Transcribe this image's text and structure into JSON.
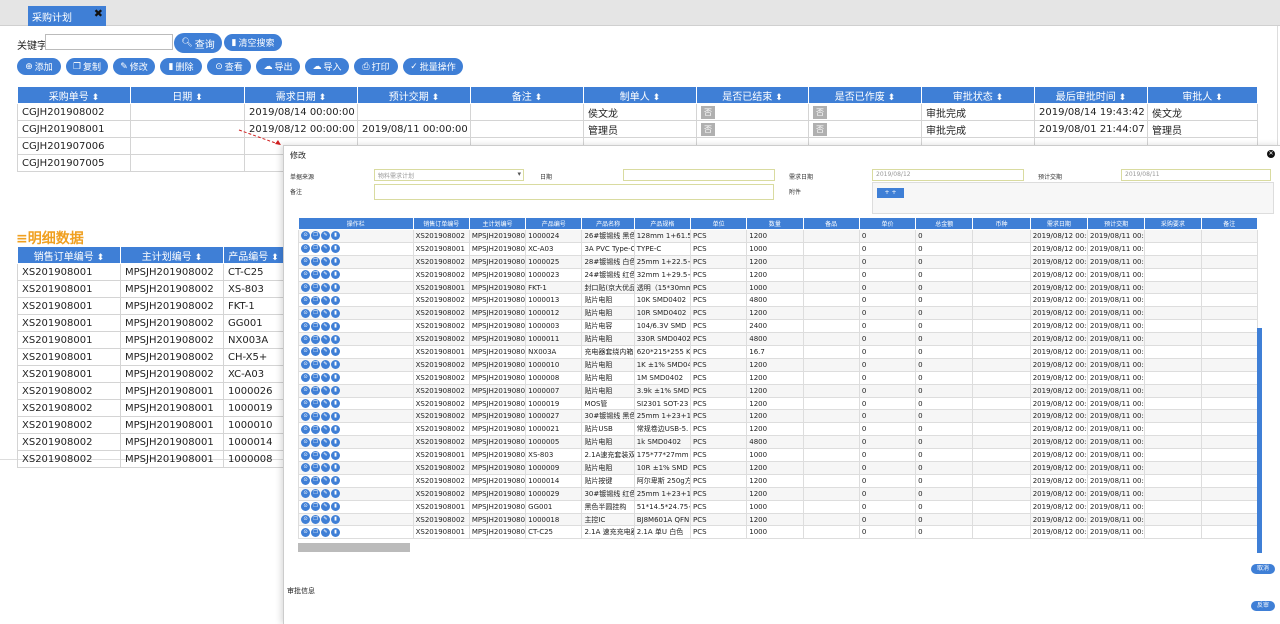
{
  "tab": {
    "title": "采购计划",
    "close": "✖"
  },
  "search": {
    "label": "关键字",
    "query": "查询",
    "clear": "清空搜索"
  },
  "toolbar": [
    "添加",
    "复制",
    "修改",
    "删除",
    "查看",
    "导出",
    "导入",
    "打印",
    "批量操作"
  ],
  "main_table": {
    "headers": [
      "采购单号",
      "日期",
      "需求日期",
      "预计交期",
      "备注",
      "制单人",
      "是否已结束",
      "是否已作废",
      "审批状态",
      "最后审批时间",
      "审批人"
    ],
    "rows": [
      [
        "CGJH201908002",
        "",
        "2019/08/14 00:00:00",
        "",
        "",
        "侯文龙",
        "否",
        "否",
        "审批完成",
        "2019/08/14 19:43:42",
        "侯文龙"
      ],
      [
        "CGJH201908001",
        "",
        "2019/08/12 00:00:00",
        "2019/08/11 00:00:00",
        "",
        "管理员",
        "否",
        "否",
        "审批完成",
        "2019/08/01 21:44:07",
        "管理员"
      ],
      [
        "CGJH201907006",
        "",
        "",
        "",
        "",
        "",
        "",
        "",
        "",
        "",
        ""
      ],
      [
        "CGJH201907005",
        "",
        "",
        "",
        "",
        "",
        "",
        "",
        "",
        "",
        ""
      ]
    ]
  },
  "detail": {
    "title": "≡明细数据",
    "headers": [
      "销售订单编号",
      "主计划编号",
      "产品编号"
    ],
    "rows": [
      [
        "XS201908001",
        "MPSJH201908002",
        "CT-C25"
      ],
      [
        "XS201908001",
        "MPSJH201908002",
        "XS-803"
      ],
      [
        "XS201908001",
        "MPSJH201908002",
        "FKT-1"
      ],
      [
        "XS201908001",
        "MPSJH201908002",
        "GG001"
      ],
      [
        "XS201908001",
        "MPSJH201908002",
        "NX003A"
      ],
      [
        "XS201908001",
        "MPSJH201908002",
        "CH-X5+"
      ],
      [
        "XS201908001",
        "MPSJH201908002",
        "XC-A03"
      ],
      [
        "XS201908002",
        "MPSJH201908001",
        "1000026"
      ],
      [
        "XS201908002",
        "MPSJH201908001",
        "1000019"
      ],
      [
        "XS201908002",
        "MPSJH201908001",
        "1000010"
      ],
      [
        "XS201908002",
        "MPSJH201908001",
        "1000014"
      ],
      [
        "XS201908002",
        "MPSJH201908001",
        "1000008"
      ]
    ]
  },
  "modal": {
    "title": "修改",
    "form": {
      "source_label": "单据来源",
      "source_value": "物料需求计划",
      "date_label": "日期",
      "date_value": "",
      "need_label": "需求日期",
      "need_value": "2019/08/12",
      "expect_label": "预计交期",
      "expect_value": "2019/08/11",
      "remark_label": "备注",
      "attach_label": "附件",
      "add_label": "+ +"
    },
    "headers": [
      "操作栏",
      "销售订单编号",
      "主计划编号",
      "产品编号",
      "产品名称",
      "产品规格",
      "单位",
      "数量",
      "备品",
      "单价",
      "总金额",
      "币种",
      "需求日期",
      "预计交期",
      "采购要求",
      "备注"
    ],
    "rows": [
      [
        "XS201908002",
        "MPSJH2019080",
        "1000024",
        "26#镀锡线 黑色",
        "128mm 1+61.5",
        "PCS",
        "1200",
        "",
        "0",
        "0",
        "",
        "2019/08/12 00:",
        "2019/08/11 00:",
        "",
        ""
      ],
      [
        "XS201908001",
        "MPSJH2019080",
        "XC-A03",
        "3A PVC Type-C数",
        "TYPE-C",
        "PCS",
        "1000",
        "",
        "0",
        "0",
        "",
        "2019/08/12 00:",
        "2019/08/11 00:",
        "",
        ""
      ],
      [
        "XS201908002",
        "MPSJH2019080",
        "1000025",
        "28#镀锡线 白色",
        "25mm 1+22.5+",
        "PCS",
        "1200",
        "",
        "0",
        "0",
        "",
        "2019/08/12 00:",
        "2019/08/11 00:",
        "",
        ""
      ],
      [
        "XS201908002",
        "MPSJH2019080",
        "1000023",
        "24#镀锡线 红色",
        "32mm 1+29.5+",
        "PCS",
        "1200",
        "",
        "0",
        "0",
        "",
        "2019/08/12 00:",
        "2019/08/11 00:",
        "",
        ""
      ],
      [
        "XS201908001",
        "MPSJH2019080",
        "FKT-1",
        "封口贴(京大优品)",
        "透明（15*30mm",
        "PCS",
        "1000",
        "",
        "0",
        "0",
        "",
        "2019/08/12 00:",
        "2019/08/11 00:",
        "",
        ""
      ],
      [
        "XS201908002",
        "MPSJH2019080",
        "1000013",
        "贴片电阻",
        "10K SMD0402",
        "PCS",
        "4800",
        "",
        "0",
        "0",
        "",
        "2019/08/12 00:",
        "2019/08/11 00:",
        "",
        ""
      ],
      [
        "XS201908002",
        "MPSJH2019080",
        "1000012",
        "贴片电阻",
        "10R SMD0402",
        "PCS",
        "1200",
        "",
        "0",
        "0",
        "",
        "2019/08/12 00:",
        "2019/08/11 00:",
        "",
        ""
      ],
      [
        "XS201908002",
        "MPSJH2019080",
        "1000003",
        "贴片电容",
        "104/6.3V SMD",
        "PCS",
        "2400",
        "",
        "0",
        "0",
        "",
        "2019/08/12 00:",
        "2019/08/11 00:",
        "",
        ""
      ],
      [
        "XS201908002",
        "MPSJH2019080",
        "1000011",
        "贴片电阻",
        "330R SMD0402",
        "PCS",
        "4800",
        "",
        "0",
        "0",
        "",
        "2019/08/12 00:",
        "2019/08/11 00:",
        "",
        ""
      ],
      [
        "XS201908001",
        "MPSJH2019080",
        "NX003A",
        "充电器套绕内箱",
        "620*215*255 K",
        "PCS",
        "16.7",
        "",
        "0",
        "0",
        "",
        "2019/08/12 00:",
        "2019/08/11 00:",
        "",
        ""
      ],
      [
        "XS201908002",
        "MPSJH2019080",
        "1000010",
        "贴片电阻",
        "1K ±1% SMD04",
        "PCS",
        "1200",
        "",
        "0",
        "0",
        "",
        "2019/08/12 00:",
        "2019/08/11 00:",
        "",
        ""
      ],
      [
        "XS201908002",
        "MPSJH2019080",
        "1000008",
        "贴片电阻",
        "1M SMD0402",
        "PCS",
        "1200",
        "",
        "0",
        "0",
        "",
        "2019/08/12 00:",
        "2019/08/11 00:",
        "",
        ""
      ],
      [
        "XS201908002",
        "MPSJH2019080",
        "1000007",
        "贴片电阻",
        "3.9k ±1% SMD",
        "PCS",
        "1200",
        "",
        "0",
        "0",
        "",
        "2019/08/12 00:",
        "2019/08/11 00:",
        "",
        ""
      ],
      [
        "XS201908002",
        "MPSJH2019080",
        "1000019",
        "MOS管",
        "SI2301 SOT-23",
        "PCS",
        "1200",
        "",
        "0",
        "0",
        "",
        "2019/08/12 00:",
        "2019/08/11 00:",
        "",
        ""
      ],
      [
        "XS201908002",
        "MPSJH2019080",
        "1000027",
        "30#镀锡线 黑色",
        "25mm 1+23+1",
        "PCS",
        "1200",
        "",
        "0",
        "0",
        "",
        "2019/08/12 00:",
        "2019/08/11 00:",
        "",
        ""
      ],
      [
        "XS201908002",
        "MPSJH2019080",
        "1000021",
        "贴片USB",
        "常规卷边USB-5.",
        "PCS",
        "1200",
        "",
        "0",
        "0",
        "",
        "2019/08/12 00:",
        "2019/08/11 00:",
        "",
        ""
      ],
      [
        "XS201908002",
        "MPSJH2019080",
        "1000005",
        "贴片电阻",
        "1k SMD0402",
        "PCS",
        "4800",
        "",
        "0",
        "0",
        "",
        "2019/08/12 00:",
        "2019/08/11 00:",
        "",
        ""
      ],
      [
        "XS201908001",
        "MPSJH2019080",
        "XS-803",
        "2.1A速充套装双封",
        "175*77*27mm",
        "PCS",
        "1000",
        "",
        "0",
        "0",
        "",
        "2019/08/12 00:",
        "2019/08/11 00:",
        "",
        ""
      ],
      [
        "XS201908002",
        "MPSJH2019080",
        "1000009",
        "贴片电阻",
        "10R ±1% SMD",
        "PCS",
        "1200",
        "",
        "0",
        "0",
        "",
        "2019/08/12 00:",
        "2019/08/11 00:",
        "",
        ""
      ],
      [
        "XS201908002",
        "MPSJH2019080",
        "1000014",
        "贴片按键",
        "阿尔卑斯 250g方",
        "PCS",
        "1200",
        "",
        "0",
        "0",
        "",
        "2019/08/12 00:",
        "2019/08/11 00:",
        "",
        ""
      ],
      [
        "XS201908002",
        "MPSJH2019080",
        "1000029",
        "30#镀锡线 红色",
        "25mm 1+23+1",
        "PCS",
        "1200",
        "",
        "0",
        "0",
        "",
        "2019/08/12 00:",
        "2019/08/11 00:",
        "",
        ""
      ],
      [
        "XS201908001",
        "MPSJH2019080",
        "GG001",
        "黑色半圆挂构",
        "51*14.5*24.75+",
        "PCS",
        "1000",
        "",
        "0",
        "0",
        "",
        "2019/08/12 00:",
        "2019/08/11 00:",
        "",
        ""
      ],
      [
        "XS201908002",
        "MPSJH2019080",
        "1000018",
        "主控IC",
        "BJ8M601A QFN",
        "PCS",
        "1200",
        "",
        "0",
        "0",
        "",
        "2019/08/12 00:",
        "2019/08/11 00:",
        "",
        ""
      ],
      [
        "XS201908001",
        "MPSJH2019080",
        "CT-C25",
        "2.1A 速充充电器",
        "2.1A 单U 白色",
        "PCS",
        "1000",
        "",
        "0",
        "0",
        "",
        "2019/08/12 00:",
        "2019/08/11 00:",
        "",
        ""
      ]
    ],
    "cancel": "取消",
    "reject": "反审",
    "approval_label": "审批信息"
  },
  "colors": {
    "accent": "#3f7fd6",
    "section": "#f0a020"
  }
}
